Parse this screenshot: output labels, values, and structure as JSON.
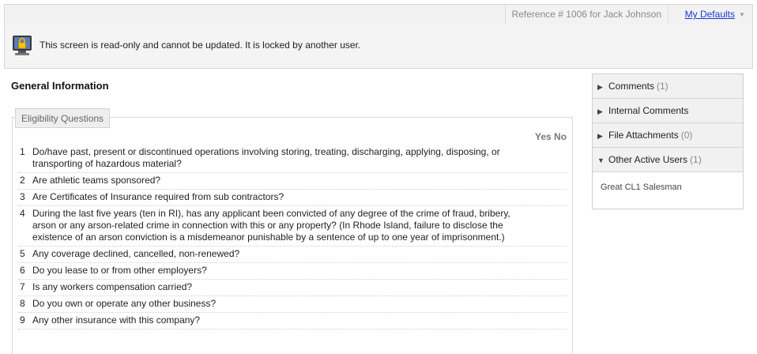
{
  "header": {
    "reference": "Reference # 1006 for Jack Johnson",
    "defaults_link": "My Defaults",
    "caret": "▼"
  },
  "lock_notice": {
    "icon": "lock-monitor-icon",
    "message": "This screen is read-only and cannot be updated. It is locked by another user."
  },
  "section": {
    "title": "General Information",
    "legend": "Eligibility Questions",
    "columns": {
      "yes_no": "Yes No"
    }
  },
  "questions": [
    {
      "num": "1",
      "text": "Do/have past, present or discontinued operations involving storing, treating, discharging, applying, disposing, or transporting of hazardous material?"
    },
    {
      "num": "2",
      "text": "Are athletic teams sponsored?"
    },
    {
      "num": "3",
      "text": "Are Certificates of Insurance required from sub contractors?"
    },
    {
      "num": "4",
      "text": "During the last five years (ten in RI), has any applicant been convicted of any degree of the crime of fraud, bribery, arson or any arson-related crime in connection with this or any property? (In Rhode Island, failure to disclose the existence of an arson conviction is a misdemeanor punishable by a sentence of up to one year of imprisonment.)"
    },
    {
      "num": "5",
      "text": "Any coverage declined, cancelled, non-renewed?"
    },
    {
      "num": "6",
      "text": "Do you lease to or from other employers?"
    },
    {
      "num": "7",
      "text": "Is any workers compensation carried?"
    },
    {
      "num": "8",
      "text": "Do you own or operate any other business?"
    },
    {
      "num": "9",
      "text": "Any other insurance with this company?"
    }
  ],
  "side_panel": {
    "items": [
      {
        "label": "Comments",
        "count": "(1)",
        "arrow": "▶"
      },
      {
        "label": "Internal Comments",
        "count": "",
        "arrow": "▶"
      },
      {
        "label": "File Attachments",
        "count": "(0)",
        "arrow": "▶"
      },
      {
        "label": "Other Active Users",
        "count": "(1)",
        "arrow": "▼"
      }
    ],
    "active_user": "Great CL1 Salesman"
  }
}
